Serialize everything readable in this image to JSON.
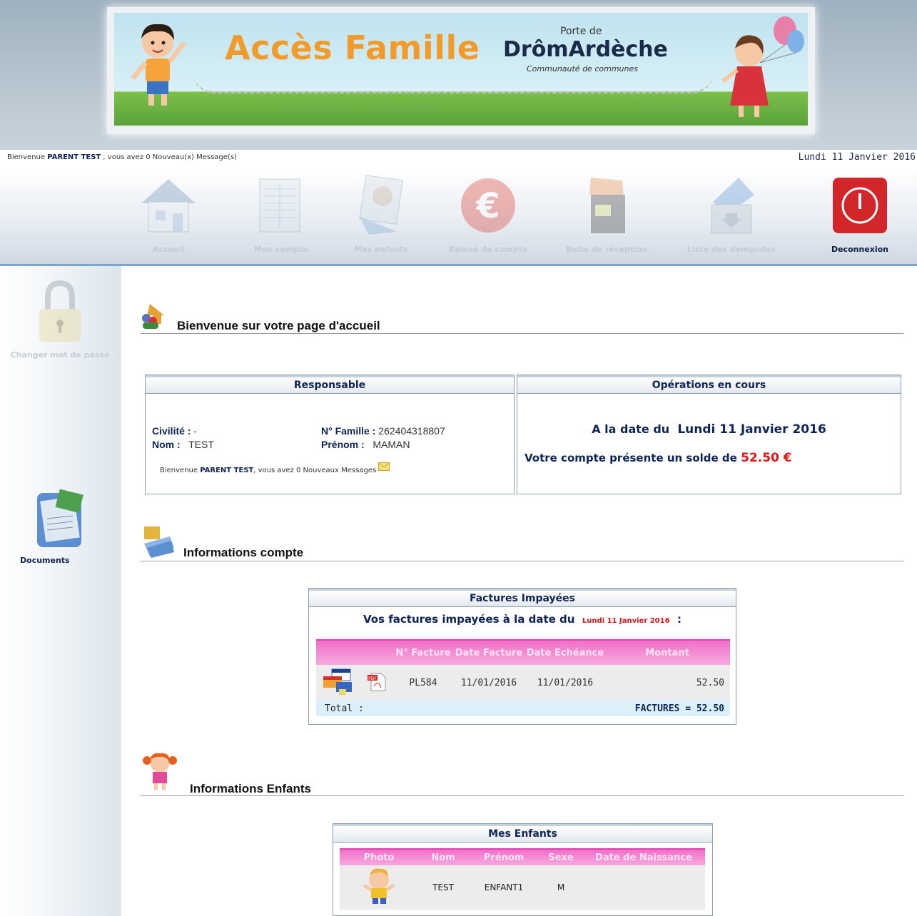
{
  "banner": {
    "title": "Accès Famille",
    "brand_top": "Porte de",
    "brand_name": "DrômArdèche",
    "brand_sub": "Communauté de communes"
  },
  "top": {
    "welcome_prefix": "Bienvenue ",
    "user": "PARENT TEST",
    "welcome_mid": " , vous avez  ",
    "messages": "0 Nouveau(x) Message(s)",
    "date": "Lundi 11 Janvier 2016"
  },
  "nav": {
    "items": [
      {
        "label": "Accueil",
        "icon": "house-icon"
      },
      {
        "label": "Mon compte",
        "icon": "account-sheet-icon"
      },
      {
        "label": "Mes enfants",
        "icon": "children-photo-icon"
      },
      {
        "label": "Relevé de compte",
        "icon": "euro-icon"
      },
      {
        "label": "Boite de réception",
        "icon": "inbox-icon"
      },
      {
        "label": "Liste des demandes",
        "icon": "requests-list-icon"
      },
      {
        "label": "Deconnexion",
        "icon": "power-icon"
      }
    ]
  },
  "sidebar": {
    "change_password": "Changer mot de passe",
    "documents": "Documents"
  },
  "home": {
    "title": "Bienvenue sur votre page d'accueil"
  },
  "responsable": {
    "header": "Responsable",
    "civilite_label": "Civilité :",
    "civilite_value": "-",
    "nom_label": "Nom :",
    "nom_value": "TEST",
    "famille_label": "N° Famille :",
    "famille_value": "262404318807",
    "prenom_label": "Prénom :",
    "prenom_value": "MAMAN",
    "welcome_prefix": "Bienvenue ",
    "user": "PARENT TEST",
    "welcome_mid": ", vous avez  ",
    "messages": "0 Nouveaux Messages"
  },
  "operations": {
    "header": "Opérations en cours",
    "date_prefix": "A la date du",
    "date": "Lundi 11 Janvier 2016",
    "solde_prefix": "Votre compte présente un solde de",
    "solde": "52.50 €"
  },
  "compte": {
    "title": "Informations compte",
    "panel_header": "Factures Impayées",
    "intro_prefix": "Vos factures impayées à la date du",
    "intro_date": "Lundi 11 Janvier 2016",
    "intro_suffix": ":",
    "columns": [
      "N° Facture",
      "Date Facture",
      "Date Echéance",
      "Montant"
    ],
    "rows": [
      {
        "facture": "PL584",
        "date_facture": "11/01/2016",
        "date_echeance": "11/01/2016",
        "montant": "52.50"
      }
    ],
    "total_label": "Total :",
    "total_value": "FACTURES = 52.50"
  },
  "enfants": {
    "title": "Informations Enfants",
    "panel_header": "Mes Enfants",
    "columns": [
      "Photo",
      "Nom",
      "Prénom",
      "Sexe",
      "Date de Naissance"
    ],
    "rows": [
      {
        "nom": "TEST",
        "prenom": "ENFANT1",
        "sexe": "M",
        "naissance": ""
      }
    ]
  }
}
